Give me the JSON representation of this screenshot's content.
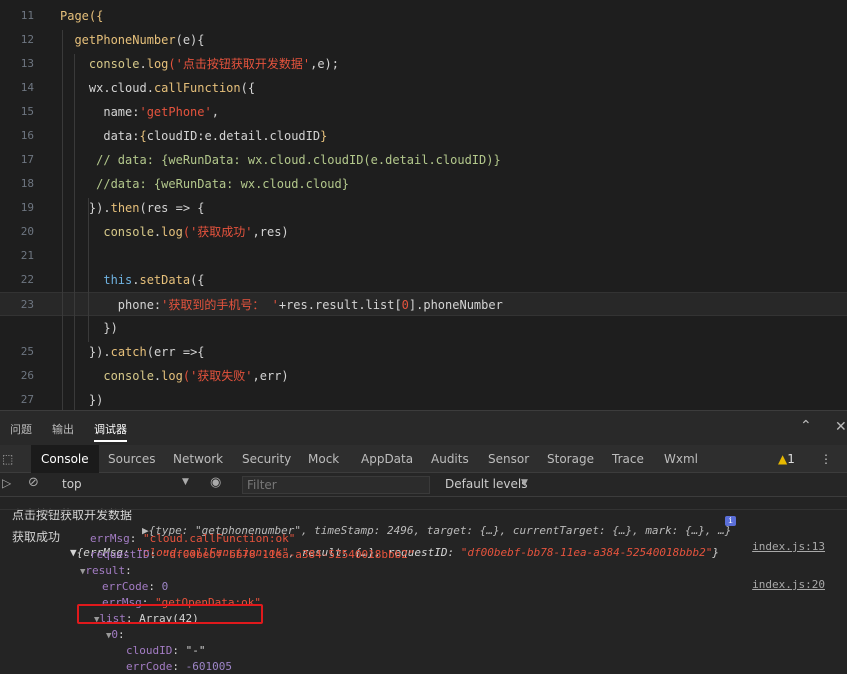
{
  "editor": {
    "lines": [
      {
        "n": "11",
        "tokens": [
          {
            "t": "Page({",
            "c": "fn"
          }
        ]
      },
      {
        "n": "12",
        "tokens": [
          {
            "t": "  getPhoneNumber",
            "c": "fn"
          },
          {
            "t": "(e){",
            "c": "txt"
          }
        ]
      },
      {
        "n": "13",
        "tokens": [
          {
            "t": "    console",
            "c": "prop"
          },
          {
            "t": ".",
            "c": "txt"
          },
          {
            "t": "log",
            "c": "fn"
          },
          {
            "t": "('点击按钮获取开发数据'",
            "c": "str"
          },
          {
            "t": ",e);",
            "c": "txt"
          }
        ]
      },
      {
        "n": "14",
        "tokens": [
          {
            "t": "    wx",
            "c": "txt"
          },
          {
            "t": ".cloud.",
            "c": "txt"
          },
          {
            "t": "callFunction",
            "c": "fn"
          },
          {
            "t": "({",
            "c": "txt"
          }
        ]
      },
      {
        "n": "15",
        "tokens": [
          {
            "t": "      name:",
            "c": "txt"
          },
          {
            "t": "'getPhone'",
            "c": "str"
          },
          {
            "t": ",",
            "c": "txt"
          }
        ]
      },
      {
        "n": "16",
        "tokens": [
          {
            "t": "      data:",
            "c": "txt"
          },
          {
            "t": "{",
            "c": "yel"
          },
          {
            "t": "cloudID:e.detail.cloudID",
            "c": "txt"
          },
          {
            "t": "}",
            "c": "yel"
          }
        ]
      },
      {
        "n": "17",
        "tokens": [
          {
            "t": "     // data: {weRunData: wx.cloud.cloudID(e.detail.cloudID)}",
            "c": "cm"
          }
        ]
      },
      {
        "n": "18",
        "tokens": [
          {
            "t": "     //data: {weRunData: wx.cloud.cloud}",
            "c": "cm"
          }
        ]
      },
      {
        "n": "19",
        "tokens": [
          {
            "t": "    })",
            "c": "txt"
          },
          {
            "t": ".",
            "c": "txt"
          },
          {
            "t": "then",
            "c": "fn"
          },
          {
            "t": "(res => {",
            "c": "txt"
          }
        ]
      },
      {
        "n": "20",
        "tokens": [
          {
            "t": "      console",
            "c": "prop"
          },
          {
            "t": ".",
            "c": "txt"
          },
          {
            "t": "log",
            "c": "fn"
          },
          {
            "t": "('获取成功'",
            "c": "str"
          },
          {
            "t": ",res)",
            "c": "txt"
          }
        ]
      },
      {
        "n": "21",
        "tokens": []
      },
      {
        "n": "22",
        "tokens": [
          {
            "t": "      this",
            "c": "kw"
          },
          {
            "t": ".",
            "c": "txt"
          },
          {
            "t": "setData",
            "c": "fn"
          },
          {
            "t": "({",
            "c": "txt"
          }
        ]
      },
      {
        "n": "23",
        "tokens": [
          {
            "t": "        phone:",
            "c": "txt"
          },
          {
            "t": "'获取到的手机号： '",
            "c": "str"
          },
          {
            "t": "+res.result.list[",
            "c": "txt"
          },
          {
            "t": "0",
            "c": "num"
          },
          {
            "t": "].phoneNumber",
            "c": "txt"
          }
        ]
      },
      {
        "n": "",
        "tokens": [
          {
            "t": "      })",
            "c": "txt"
          }
        ]
      },
      {
        "n": "25",
        "tokens": [
          {
            "t": "    })",
            "c": "txt"
          },
          {
            "t": ".",
            "c": "txt"
          },
          {
            "t": "catch",
            "c": "fn"
          },
          {
            "t": "(err =>{",
            "c": "txt"
          }
        ]
      },
      {
        "n": "26",
        "tokens": [
          {
            "t": "      console",
            "c": "prop"
          },
          {
            "t": ".",
            "c": "txt"
          },
          {
            "t": "log",
            "c": "fn"
          },
          {
            "t": "('获取失败'",
            "c": "str"
          },
          {
            "t": ",err)",
            "c": "txt"
          }
        ]
      },
      {
        "n": "27",
        "tokens": [
          {
            "t": "    })",
            "c": "txt"
          }
        ]
      }
    ]
  },
  "panel_tabs": {
    "issues": "问题",
    "output": "输出",
    "debugger": "调试器"
  },
  "devtools_tabs": [
    "Console",
    "Sources",
    "Network",
    "Security",
    "Mock",
    "AppData",
    "Audits",
    "Sensor",
    "Storage",
    "Trace",
    "Wxml"
  ],
  "warning_count": "1",
  "filter": {
    "context": "top",
    "placeholder": "Filter",
    "levels": "Default levels"
  },
  "console": {
    "top_partial": {
      "label": "点击按钮获取开发数据",
      "text": "▶{type: \"getphonenumber\", timeStamp: 2496, target: {…}, currentTarget: {…}, mark: {…}, …}",
      "src": "index.js:13"
    },
    "entry": {
      "label": "获取成功",
      "summary_open": "▼{errMsg: ",
      "summary_errmsg": "\"cloud.callFunction:ok\"",
      "summary_mid": ", result: {…}, requestID: ",
      "summary_reqid": "\"df00bebf-bb78-11ea-a384-52540018bbb2\"",
      "summary_close": "}",
      "src": "index.js:20"
    },
    "rows": [
      {
        "indent": 90,
        "key": "errMsg",
        "value": "\"cloud.callFunction:ok\"",
        "vt": "cs"
      },
      {
        "indent": 90,
        "key": "requestID",
        "value": "\"df00bebf-bb78-11ea-a384-52540018bbb2\"",
        "vt": "cs"
      },
      {
        "indent": 80,
        "key": "▼result",
        "value": "",
        "vt": "cv"
      },
      {
        "indent": 102,
        "key": "errCode",
        "value": "0",
        "vt": "cn"
      },
      {
        "indent": 102,
        "key": "errMsg",
        "value": "\"getOpenData:ok\"",
        "vt": "cs"
      },
      {
        "indent": 94,
        "key": "▼list",
        "value": "Array(42)",
        "vt": "cv"
      },
      {
        "indent": 106,
        "key": "▼0",
        "value": "",
        "vt": "cv"
      },
      {
        "indent": 126,
        "key": "cloudID",
        "value": "\"-\"",
        "vt": "cv"
      },
      {
        "indent": 126,
        "key": "errCode",
        "value": "-601005",
        "vt": "cn"
      }
    ]
  }
}
